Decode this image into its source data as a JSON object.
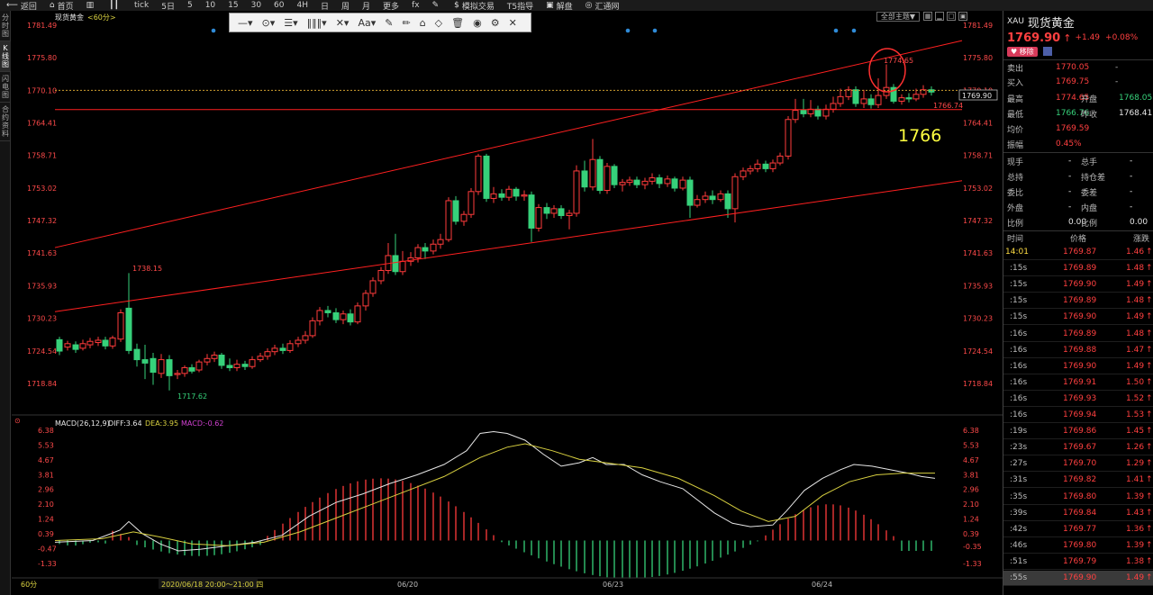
{
  "toolbar": {
    "items": [
      {
        "icon": "back-icon",
        "label": "返回"
      },
      {
        "icon": "home-icon",
        "label": "首页"
      },
      {
        "icon": "bars-icon",
        "label": ""
      },
      {
        "icon": "candles-icon",
        "label": ""
      },
      {
        "icon": "",
        "label": "tick"
      },
      {
        "icon": "",
        "label": "5日"
      },
      {
        "icon": "",
        "label": "5"
      },
      {
        "icon": "",
        "label": "10"
      },
      {
        "icon": "",
        "label": "15"
      },
      {
        "icon": "",
        "label": "30"
      },
      {
        "icon": "",
        "label": "60"
      },
      {
        "icon": "",
        "label": "4H"
      },
      {
        "icon": "",
        "label": "日"
      },
      {
        "icon": "",
        "label": "周"
      },
      {
        "icon": "",
        "label": "月"
      },
      {
        "icon": "",
        "label": "更多"
      },
      {
        "icon": "fx-icon",
        "label": "fx"
      },
      {
        "icon": "pen-icon",
        "label": ""
      },
      {
        "icon": "dollar-icon",
        "label": "模拟交易"
      },
      {
        "icon": "t5-icon",
        "label": "T5指导"
      },
      {
        "icon": "briefcase-icon",
        "label": "解盘"
      },
      {
        "icon": "circle-icon",
        "label": "汇通网"
      }
    ]
  },
  "left_tabs": [
    "分时图",
    "K线图",
    "闪电图",
    "合约资料"
  ],
  "chart_title": "现货黄金",
  "chart_period": "<60分>",
  "drawing_tools": [
    "—▾",
    "⊙▾",
    "☰▾",
    "‖‖‖▾",
    "✕▾",
    "Aa▾",
    "✎",
    "✏",
    "⌂",
    "◇",
    "🗑",
    "◉",
    "⚙",
    "✕"
  ],
  "theme_button": "全部主题▼",
  "price_axis": [
    "1781.49",
    "1775.80",
    "1770.10",
    "1764.41",
    "1758.71",
    "1753.02",
    "1747.32",
    "1741.63",
    "1735.93",
    "1730.23",
    "1724.54",
    "1718.84"
  ],
  "macd_axis": [
    "6.38",
    "5.53",
    "4.67",
    "3.81",
    "2.96",
    "2.10",
    "1.24",
    "0.39",
    "-0.47",
    "-1.33"
  ],
  "macd_axis_right": [
    "6.38",
    "5.53",
    "4.67",
    "3.81",
    "2.96",
    "2.10",
    "1.24",
    "0.39",
    "-0.35",
    "-1.33"
  ],
  "macd_legend": {
    "label": "MACD(26,12,9)",
    "diff": "DIFF:3.64",
    "dea": "DEA:3.95",
    "macd": "MACD:-0.62"
  },
  "annotations": {
    "high": "1774.65",
    "low": "1717.62",
    "peak": "1738.15",
    "right_low": "1766.74",
    "current_tag": "1769.90",
    "handwritten": "1766"
  },
  "x_labels": [
    "06/20",
    "06/23",
    "06/24"
  ],
  "bottom_info": {
    "period": "60分",
    "cursor_time": "2020/06/18 20:00～21:00 四"
  },
  "colors": {
    "up": "#ff3b3b",
    "down": "#36d17a",
    "diff": "#e6e6e6",
    "dea": "#d8d040",
    "trend": "#ff2020",
    "accent": "#ffff40"
  },
  "quote": {
    "code": "XAU",
    "name": "现货黄金",
    "price": "1769.90",
    "arrow": "↑",
    "change": "+1.49",
    "change_pct": "+0.08%",
    "remove_btn": "移除",
    "sell_label": "卖出",
    "sell_value": "1770.05",
    "sell_vol": "-",
    "buy_label": "买入",
    "buy_value": "1769.75",
    "buy_vol": "-",
    "high_label": "最高",
    "high_value": "1774.65",
    "open_label": "开盘",
    "open_value": "1768.05",
    "low_label": "最低",
    "low_value": "1766.76",
    "prev_label": "昨收",
    "prev_value": "1768.41",
    "avg_label": "均价",
    "avg_value": "1769.59",
    "amp_label": "振幅",
    "amp_value": "0.45%",
    "stats": [
      {
        "l1": "现手",
        "v1": "-",
        "l2": "总手",
        "v2": "-"
      },
      {
        "l1": "总持",
        "v1": "-",
        "l2": "持仓差",
        "v2": "-"
      },
      {
        "l1": "委比",
        "v1": "-",
        "l2": "委差",
        "v2": "-"
      },
      {
        "l1": "外盘",
        "v1": "-",
        "l2": "内盘",
        "v2": "-"
      },
      {
        "l1": "比例",
        "v1": "0.00",
        "l2": "比例",
        "v2": "0.00"
      }
    ]
  },
  "ticks_header": {
    "time": "时间",
    "price": "价格",
    "change": "涨跌"
  },
  "ticks": [
    {
      "time": "14:01",
      "price": "1769.87",
      "change": "1.46"
    },
    {
      "time": ":15s",
      "price": "1769.89",
      "change": "1.48"
    },
    {
      "time": ":15s",
      "price": "1769.90",
      "change": "1.49"
    },
    {
      "time": ":15s",
      "price": "1769.89",
      "change": "1.48"
    },
    {
      "time": ":15s",
      "price": "1769.90",
      "change": "1.49"
    },
    {
      "time": ":16s",
      "price": "1769.89",
      "change": "1.48"
    },
    {
      "time": ":16s",
      "price": "1769.88",
      "change": "1.47"
    },
    {
      "time": ":16s",
      "price": "1769.90",
      "change": "1.49"
    },
    {
      "time": ":16s",
      "price": "1769.91",
      "change": "1.50"
    },
    {
      "time": ":16s",
      "price": "1769.93",
      "change": "1.52"
    },
    {
      "time": ":16s",
      "price": "1769.94",
      "change": "1.53"
    },
    {
      "time": ":19s",
      "price": "1769.86",
      "change": "1.45"
    },
    {
      "time": ":23s",
      "price": "1769.67",
      "change": "1.26"
    },
    {
      "time": ":27s",
      "price": "1769.70",
      "change": "1.29"
    },
    {
      "time": ":31s",
      "price": "1769.82",
      "change": "1.41"
    },
    {
      "time": ":35s",
      "price": "1769.80",
      "change": "1.39"
    },
    {
      "time": ":39s",
      "price": "1769.84",
      "change": "1.43"
    },
    {
      "time": ":42s",
      "price": "1769.77",
      "change": "1.36"
    },
    {
      "time": ":46s",
      "price": "1769.80",
      "change": "1.39"
    },
    {
      "time": ":51s",
      "price": "1769.79",
      "change": "1.38"
    },
    {
      "time": ":55s",
      "price": "1769.90",
      "change": "1.49"
    }
  ]
}
